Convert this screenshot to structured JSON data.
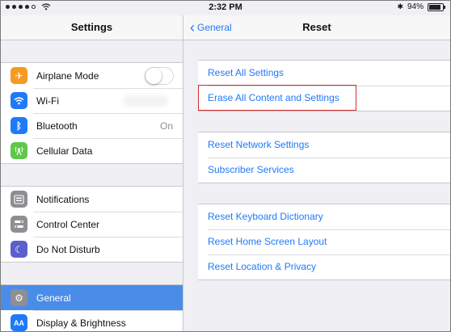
{
  "status_bar": {
    "time": "2:32 PM",
    "battery_percent": "94%",
    "battery_level": 0.94,
    "icons": [
      "signal-icon",
      "wifi-icon",
      "bluetooth-icon",
      "battery-icon"
    ]
  },
  "sidebar": {
    "title": "Settings",
    "groups": [
      [
        {
          "label": "Airplane Mode",
          "icon": "airplane-icon",
          "icon_color": "#f59a23",
          "control": "toggle",
          "toggle_on": false
        },
        {
          "label": "Wi-Fi",
          "icon": "wifi-icon",
          "icon_color": "#1f7af7",
          "value": ""
        },
        {
          "label": "Bluetooth",
          "icon": "bluetooth-icon",
          "icon_color": "#1f7af7",
          "value": "On"
        },
        {
          "label": "Cellular Data",
          "icon": "cellular-icon",
          "icon_color": "#5fc84a"
        }
      ],
      [
        {
          "label": "Notifications",
          "icon": "notifications-icon",
          "icon_color": "#8e8e93"
        },
        {
          "label": "Control Center",
          "icon": "control-center-icon",
          "icon_color": "#8e8e93"
        },
        {
          "label": "Do Not Disturb",
          "icon": "moon-icon",
          "icon_color": "#5b5fce"
        }
      ],
      [
        {
          "label": "General",
          "icon": "gear-icon",
          "icon_color": "#8e8e93",
          "selected": true
        },
        {
          "label": "Display & Brightness",
          "icon": "display-icon",
          "icon_color": "#1f7af7"
        }
      ]
    ]
  },
  "main": {
    "back_label": "General",
    "title": "Reset",
    "groups": [
      [
        "Reset All Settings",
        "Erase All Content and Settings"
      ],
      [
        "Reset Network Settings",
        "Subscriber Services"
      ],
      [
        "Reset Keyboard Dictionary",
        "Reset Home Screen Layout",
        "Reset Location & Privacy"
      ]
    ],
    "highlighted_item": "Erase All Content and Settings",
    "accent_color": "#1f7af7",
    "highlight_color": "#d22b2b"
  }
}
